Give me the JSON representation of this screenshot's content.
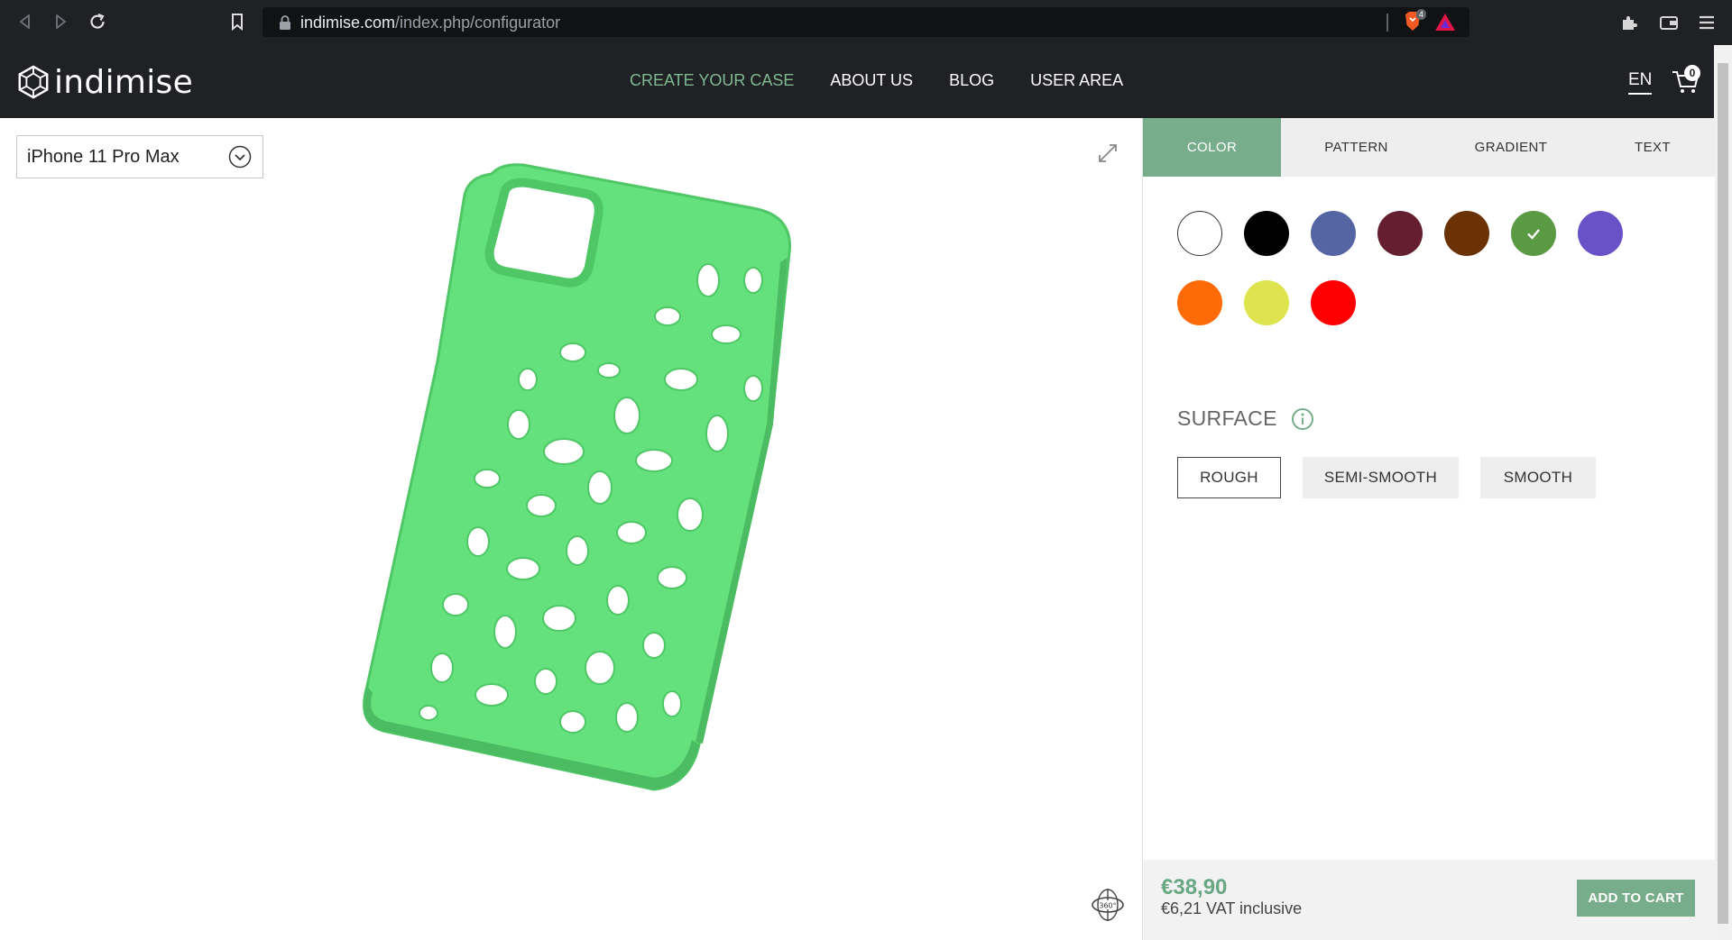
{
  "browser": {
    "url_host": "indimise.com",
    "url_path": "/index.php/configurator",
    "brave_badge_count": "4"
  },
  "header": {
    "logo_text": "indimise",
    "nav": [
      "CREATE YOUR CASE",
      "ABOUT US",
      "BLOG",
      "USER AREA"
    ],
    "active_nav": "CREATE YOUR CASE",
    "language": "EN",
    "cart_count": "0"
  },
  "viewer": {
    "selected_model": "iPhone 11 Pro Max",
    "case_color": "#64e07c",
    "rotate_label": "360°"
  },
  "panel": {
    "tabs": [
      "COLOR",
      "PATTERN",
      "GRADIENT",
      "TEXT"
    ],
    "active_tab": "COLOR",
    "colors": [
      "#ffffff",
      "#000000",
      "#5565a3",
      "#641e2f",
      "#6b3206",
      "#5a9a43",
      "#6952c7",
      "#ff6a08",
      "#dde44f",
      "#ff0000"
    ],
    "selected_color_index": 5,
    "surface_title": "SURFACE",
    "surface_options": [
      "ROUGH",
      "SEMI-SMOOTH",
      "SMOOTH"
    ],
    "selected_surface": "ROUGH",
    "price": "€38,90",
    "vat": "€6,21 VAT inclusive",
    "add_to_cart": "ADD TO CART"
  },
  "colors": {
    "accent": "#77ad8a",
    "header_bg": "#202124"
  }
}
